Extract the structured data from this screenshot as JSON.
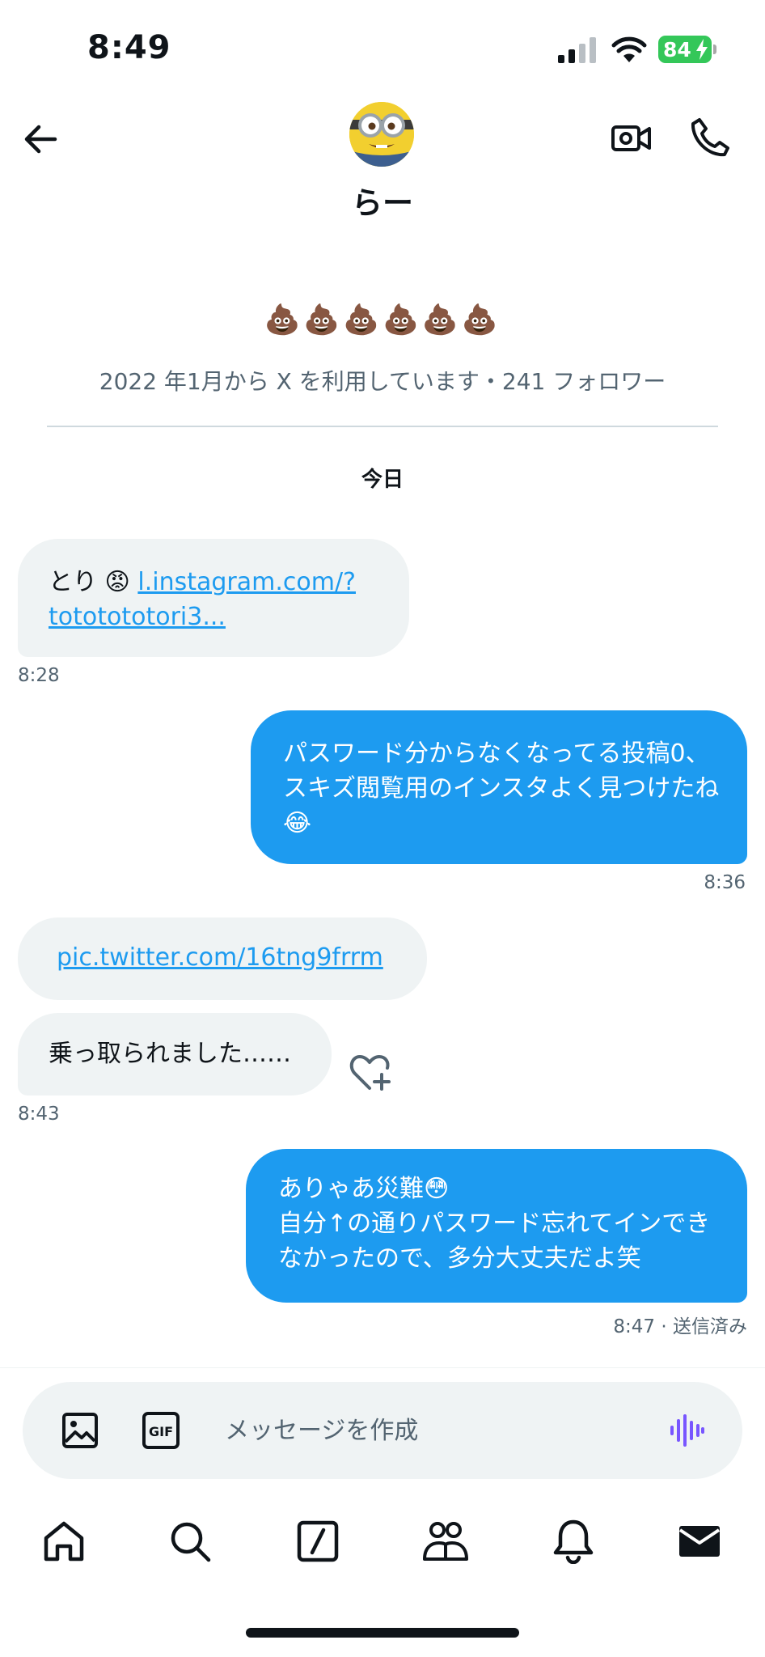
{
  "status_bar": {
    "time": "8:49",
    "battery": "84"
  },
  "header": {
    "name": "らー"
  },
  "profile": {
    "bio": "💩💩💩💩💩💩",
    "meta": "2022 年1月から X を利用しています・241 フォロワー"
  },
  "date_separator": "今日",
  "messages": [
    {
      "prefix": "とり 😡 ",
      "link": "l.instagram.com/?tototototori3...",
      "time": "8:28"
    },
    {
      "text": "パスワード分からなくなってる投稿0、スキズ閲覧用のインスタよく見つけたね😂",
      "time": "8:36"
    },
    {
      "link": "pic.twitter.com/16tng9frrm"
    },
    {
      "text": "乗っ取られました……",
      "time": "8:43"
    },
    {
      "text": "ありゃあ災難😳\n自分↑の通りパスワード忘れてインできなかったので、多分大丈夫だよ笑",
      "time": "8:47 · 送信済み"
    }
  ],
  "composer": {
    "gif_label": "GIF",
    "placeholder": "メッセージを作成"
  },
  "icons": {
    "back": "arrow-left-icon",
    "video": "video-camera-icon",
    "call": "phone-icon",
    "add_reaction": "heart-plus-icon",
    "image": "image-icon",
    "voice": "voice-waveform-icon",
    "tabs": [
      "home-icon",
      "search-icon",
      "grok-icon",
      "communities-icon",
      "notifications-icon",
      "messages-icon"
    ]
  },
  "colors": {
    "accent": "#1d9bf0",
    "incoming_bubble": "#eff3f4",
    "battery": "#34c759",
    "voice_icon": "#7856ff"
  }
}
